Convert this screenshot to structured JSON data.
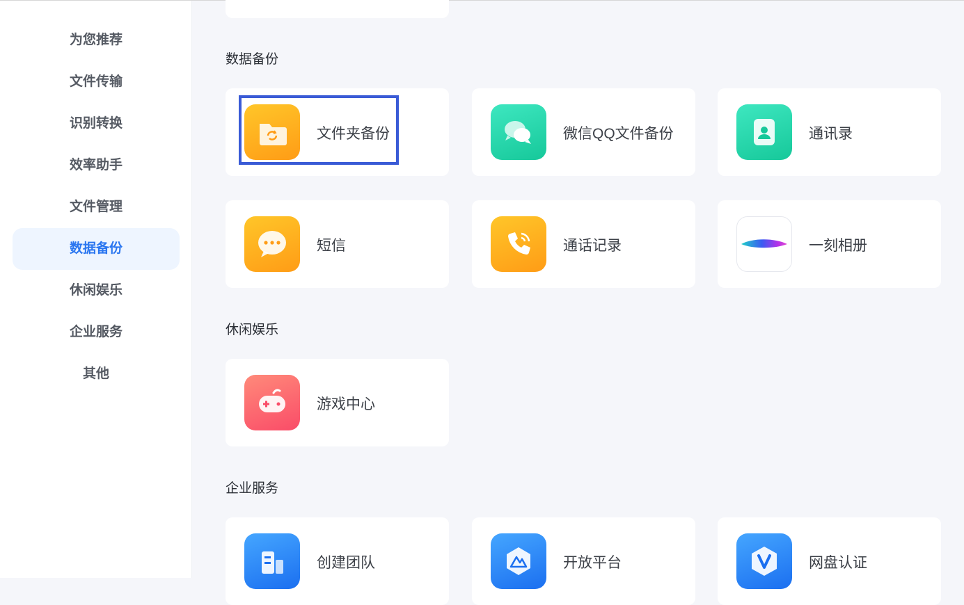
{
  "sidebar": {
    "items": [
      {
        "label": "为您推荐"
      },
      {
        "label": "文件传输"
      },
      {
        "label": "识别转换"
      },
      {
        "label": "效率助手"
      },
      {
        "label": "文件管理"
      },
      {
        "label": "数据备份"
      },
      {
        "label": "休闲娱乐"
      },
      {
        "label": "企业服务"
      },
      {
        "label": "其他"
      }
    ],
    "active_index": 5
  },
  "sections": {
    "backup": {
      "title": "数据备份",
      "cards": [
        {
          "label": "文件夹备份",
          "icon": "folder-sync-icon"
        },
        {
          "label": "微信QQ文件备份",
          "icon": "chat-bubbles-icon"
        },
        {
          "label": "通讯录",
          "icon": "contact-card-icon"
        },
        {
          "label": "短信",
          "icon": "message-dots-icon"
        },
        {
          "label": "通话记录",
          "icon": "phone-call-icon"
        },
        {
          "label": "一刻相册",
          "icon": "moment-album-icon"
        }
      ]
    },
    "leisure": {
      "title": "休闲娱乐",
      "cards": [
        {
          "label": "游戏中心",
          "icon": "gamepad-icon"
        }
      ]
    },
    "enterprise": {
      "title": "企业服务",
      "cards": [
        {
          "label": "创建团队",
          "icon": "building-icon"
        },
        {
          "label": "开放平台",
          "icon": "open-platform-icon"
        },
        {
          "label": "网盘认证",
          "icon": "verified-v-icon"
        }
      ]
    }
  },
  "colors": {
    "accent": "#2a76f0",
    "highlight_box": "#3a5bd6",
    "orange": "#ff9c16",
    "green": "#16c89a",
    "red": "#fa4c68",
    "blue": "#1b6ff0"
  }
}
